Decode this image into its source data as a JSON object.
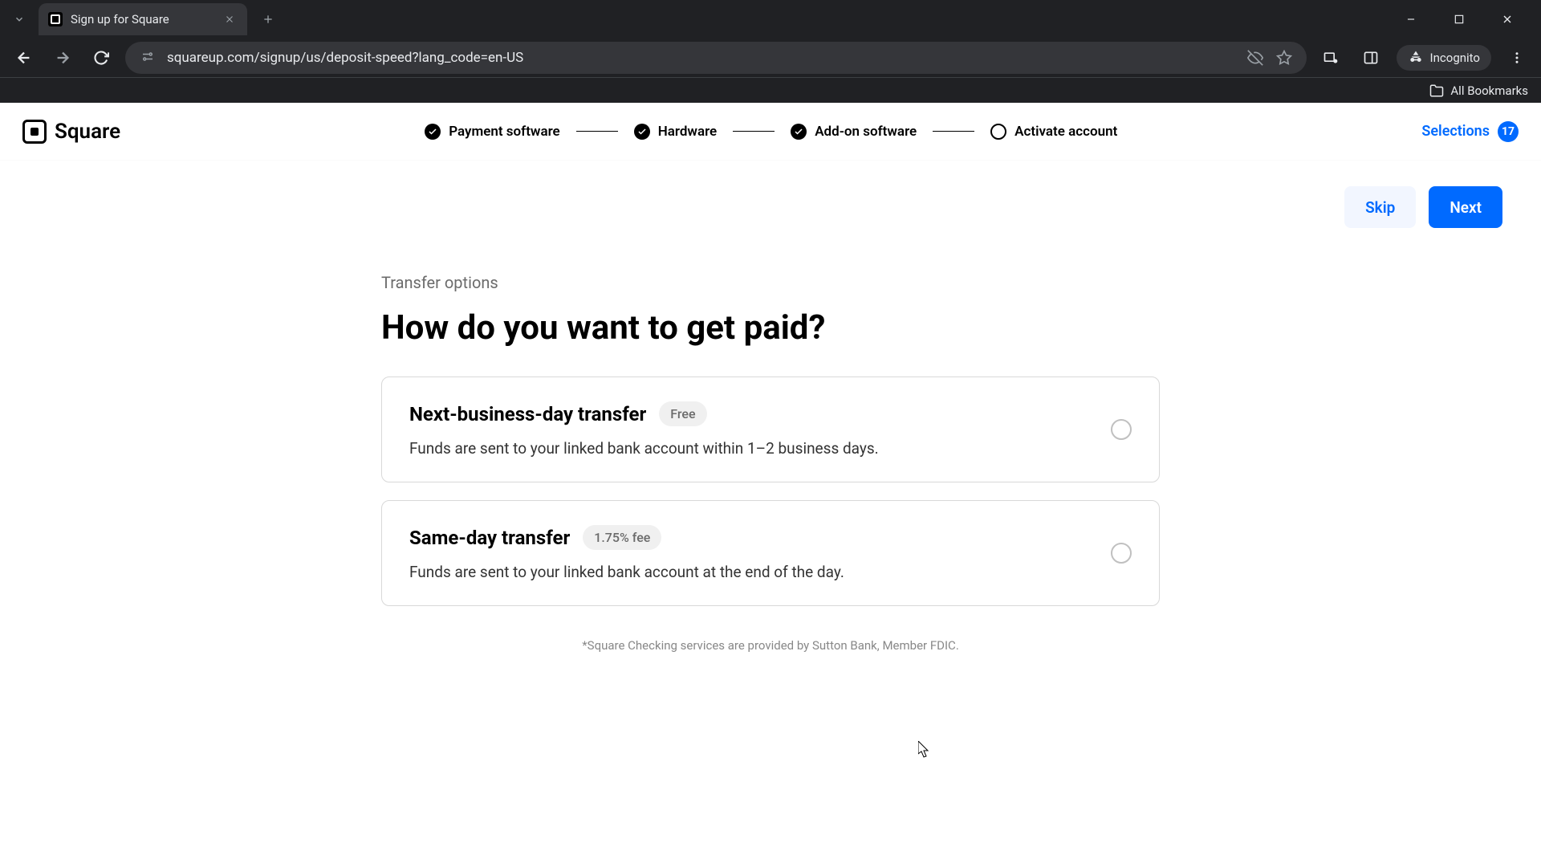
{
  "browser": {
    "tab_title": "Sign up for Square",
    "url": "squareup.com/signup/us/deposit-speed?lang_code=en-US",
    "incognito_label": "Incognito",
    "bookmarks_label": "All Bookmarks"
  },
  "header": {
    "logo_text": "Square",
    "steps": [
      {
        "label": "Payment software",
        "state": "done"
      },
      {
        "label": "Hardware",
        "state": "done"
      },
      {
        "label": "Add-on software",
        "state": "done"
      },
      {
        "label": "Activate account",
        "state": "current"
      }
    ],
    "selections_label": "Selections",
    "selections_count": "17"
  },
  "actions": {
    "skip": "Skip",
    "next": "Next"
  },
  "content": {
    "subtitle": "Transfer options",
    "heading": "How do you want to get paid?",
    "options": [
      {
        "title": "Next-business-day transfer",
        "badge": "Free",
        "desc": "Funds are sent to your linked bank account within 1–2 business days."
      },
      {
        "title": "Same-day transfer",
        "badge": "1.75% fee",
        "desc": "Funds are sent to your linked bank account at the end of the day."
      }
    ],
    "footnote": "*Square Checking services are provided by Sutton Bank, Member FDIC."
  }
}
